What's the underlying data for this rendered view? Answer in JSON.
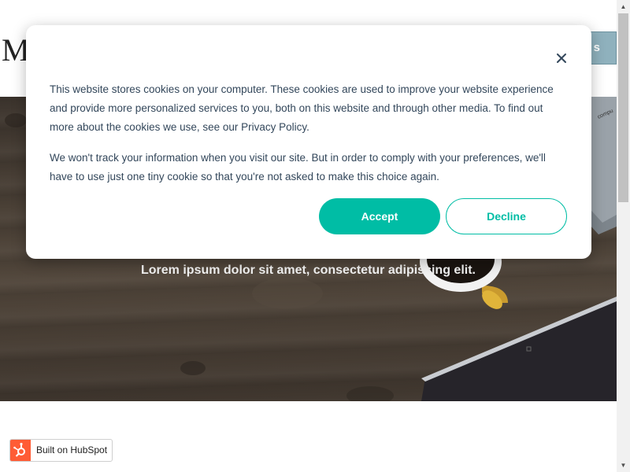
{
  "header": {
    "logo_text": "M",
    "button_label": "s"
  },
  "hero": {
    "subtitle": "Lorem ipsum dolor sit amet, consectetur adipiscing elit.",
    "laptop_label": "compu"
  },
  "cookie_banner": {
    "paragraph_1": "This website stores cookies on your computer. These cookies are used to improve your website experience and provide more personalized services to you, both on this website and through other media. To find out more about the cookies we use, see our Privacy Policy.",
    "paragraph_2": "We won't track your information when you visit our site. But in order to comply with your preferences, we'll have to use just one tiny cookie so that you're not asked to make this choice again.",
    "accept_label": "Accept",
    "decline_label": "Decline",
    "close_icon": "close-icon"
  },
  "hubspot_badge": {
    "label": "Built on HubSpot",
    "icon": "hubspot-sprocket-icon"
  },
  "scrollbar": {
    "up_arrow": "▲",
    "down_arrow": "▼"
  },
  "colors": {
    "accent": "#00bda5",
    "text": "#33475b",
    "header_button": "#8fb1bd",
    "hubspot_orange": "#ff5c35"
  }
}
